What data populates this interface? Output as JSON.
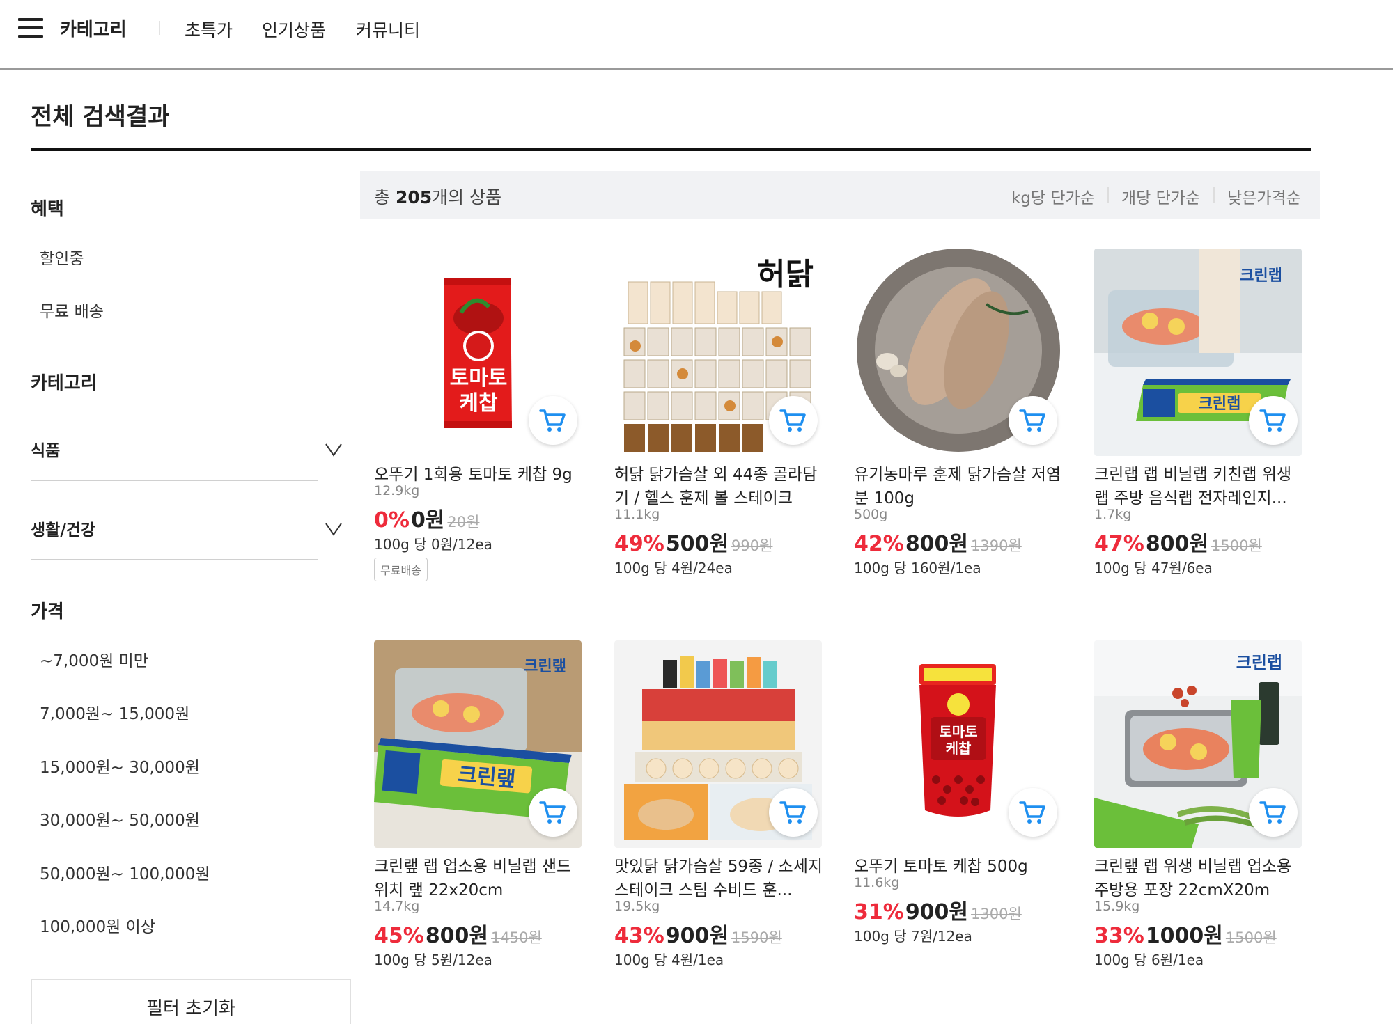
{
  "nav": {
    "category_label": "카테고리",
    "links": [
      "초특가",
      "인기상품",
      "커뮤니티"
    ]
  },
  "page": {
    "title": "전체 검색결과"
  },
  "sidebar": {
    "benefit_title": "혜택",
    "benefit_items": [
      "할인중",
      "무료 배송"
    ],
    "category_title": "카테고리",
    "categories": [
      {
        "label": "식품"
      },
      {
        "label": "생활/건강"
      }
    ],
    "price_title": "가격",
    "price_items": [
      "~7,000원 미만",
      "7,000원~ 15,000원",
      "15,000원~ 30,000원",
      "30,000원~ 50,000원",
      "50,000원~ 100,000원",
      "100,000원 이상"
    ],
    "reset_label": "필터 초기화"
  },
  "results": {
    "count_prefix": "총 ",
    "count": "205",
    "count_suffix": "개의 상품",
    "sort_options": [
      "kg당 단가순",
      "개당 단가순",
      "낮은가격순"
    ]
  },
  "products": [
    {
      "name": "오뚜기 1회용 토마토 케찹 9g",
      "weight": "12.9kg",
      "discount": "0%",
      "price": "0원",
      "original": "20원",
      "unit": "100g 당 0원/12ea",
      "badge": "무료배송",
      "icon": "ketchup-pouch"
    },
    {
      "name": "허닭 닭가슴살 외 44종 골라담기 / 헬스 훈제 볼 스테이크",
      "weight": "11.1kg",
      "discount": "49%",
      "price": "500원",
      "original": "990원",
      "unit": "100g 당 4원/24ea",
      "badge": "",
      "icon": "chicken-products",
      "logo": "허닭"
    },
    {
      "name": "유기농마루 훈제 닭가슴살 저염분 100g",
      "weight": "500g",
      "discount": "42%",
      "price": "800원",
      "original": "1390원",
      "unit": "100g 당 160원/1ea",
      "badge": "",
      "icon": "chicken-breast-plate"
    },
    {
      "name": "크린랩 랩 비닐랩 키친랩 위생랩 주방 음식랩 전자레인지...",
      "weight": "1.7kg",
      "discount": "47%",
      "price": "800원",
      "original": "1500원",
      "unit": "100g 당 47원/6ea",
      "badge": "",
      "icon": "cleanwrap-box",
      "logo": "크린랩"
    },
    {
      "name": "크린랲 랩 업소용 비닐랩 샌드위치 랲 22x20cm",
      "weight": "14.7kg",
      "discount": "45%",
      "price": "800원",
      "original": "1450원",
      "unit": "100g 당 5원/12ea",
      "badge": "",
      "icon": "cleanwrap-box",
      "logo": "크린랲"
    },
    {
      "name": "맛있닭 닭가슴살 59종 / 소세지 스테이크 스팀 수비드 훈...",
      "weight": "19.5kg",
      "discount": "43%",
      "price": "900원",
      "original": "1590원",
      "unit": "100g 당 4원/1ea",
      "badge": "",
      "icon": "chicken-products"
    },
    {
      "name": "오뚜기 토마토 케찹 500g",
      "weight": "11.6kg",
      "discount": "31%",
      "price": "900원",
      "original": "1300원",
      "unit": "100g 당 7원/12ea",
      "badge": "",
      "icon": "ketchup-bottle",
      "logo": "토마토 케찹"
    },
    {
      "name": "크린랲 랩 위생 비닐랩 업소용 주방용 포장 22cmX20m",
      "weight": "15.9kg",
      "discount": "33%",
      "price": "1000원",
      "original": "1500원",
      "unit": "100g 당 6원/1ea",
      "badge": "",
      "icon": "cleanwrap-salmon",
      "logo": "크린랩"
    }
  ],
  "colors": {
    "discount": "#ee2b3b",
    "cart_icon": "#1e8ff0",
    "result_bar": "#f1f2f4"
  },
  "icons": {
    "menu": "hamburger-icon",
    "accordion": "chevron-down-icon",
    "cart": "cart-icon"
  }
}
